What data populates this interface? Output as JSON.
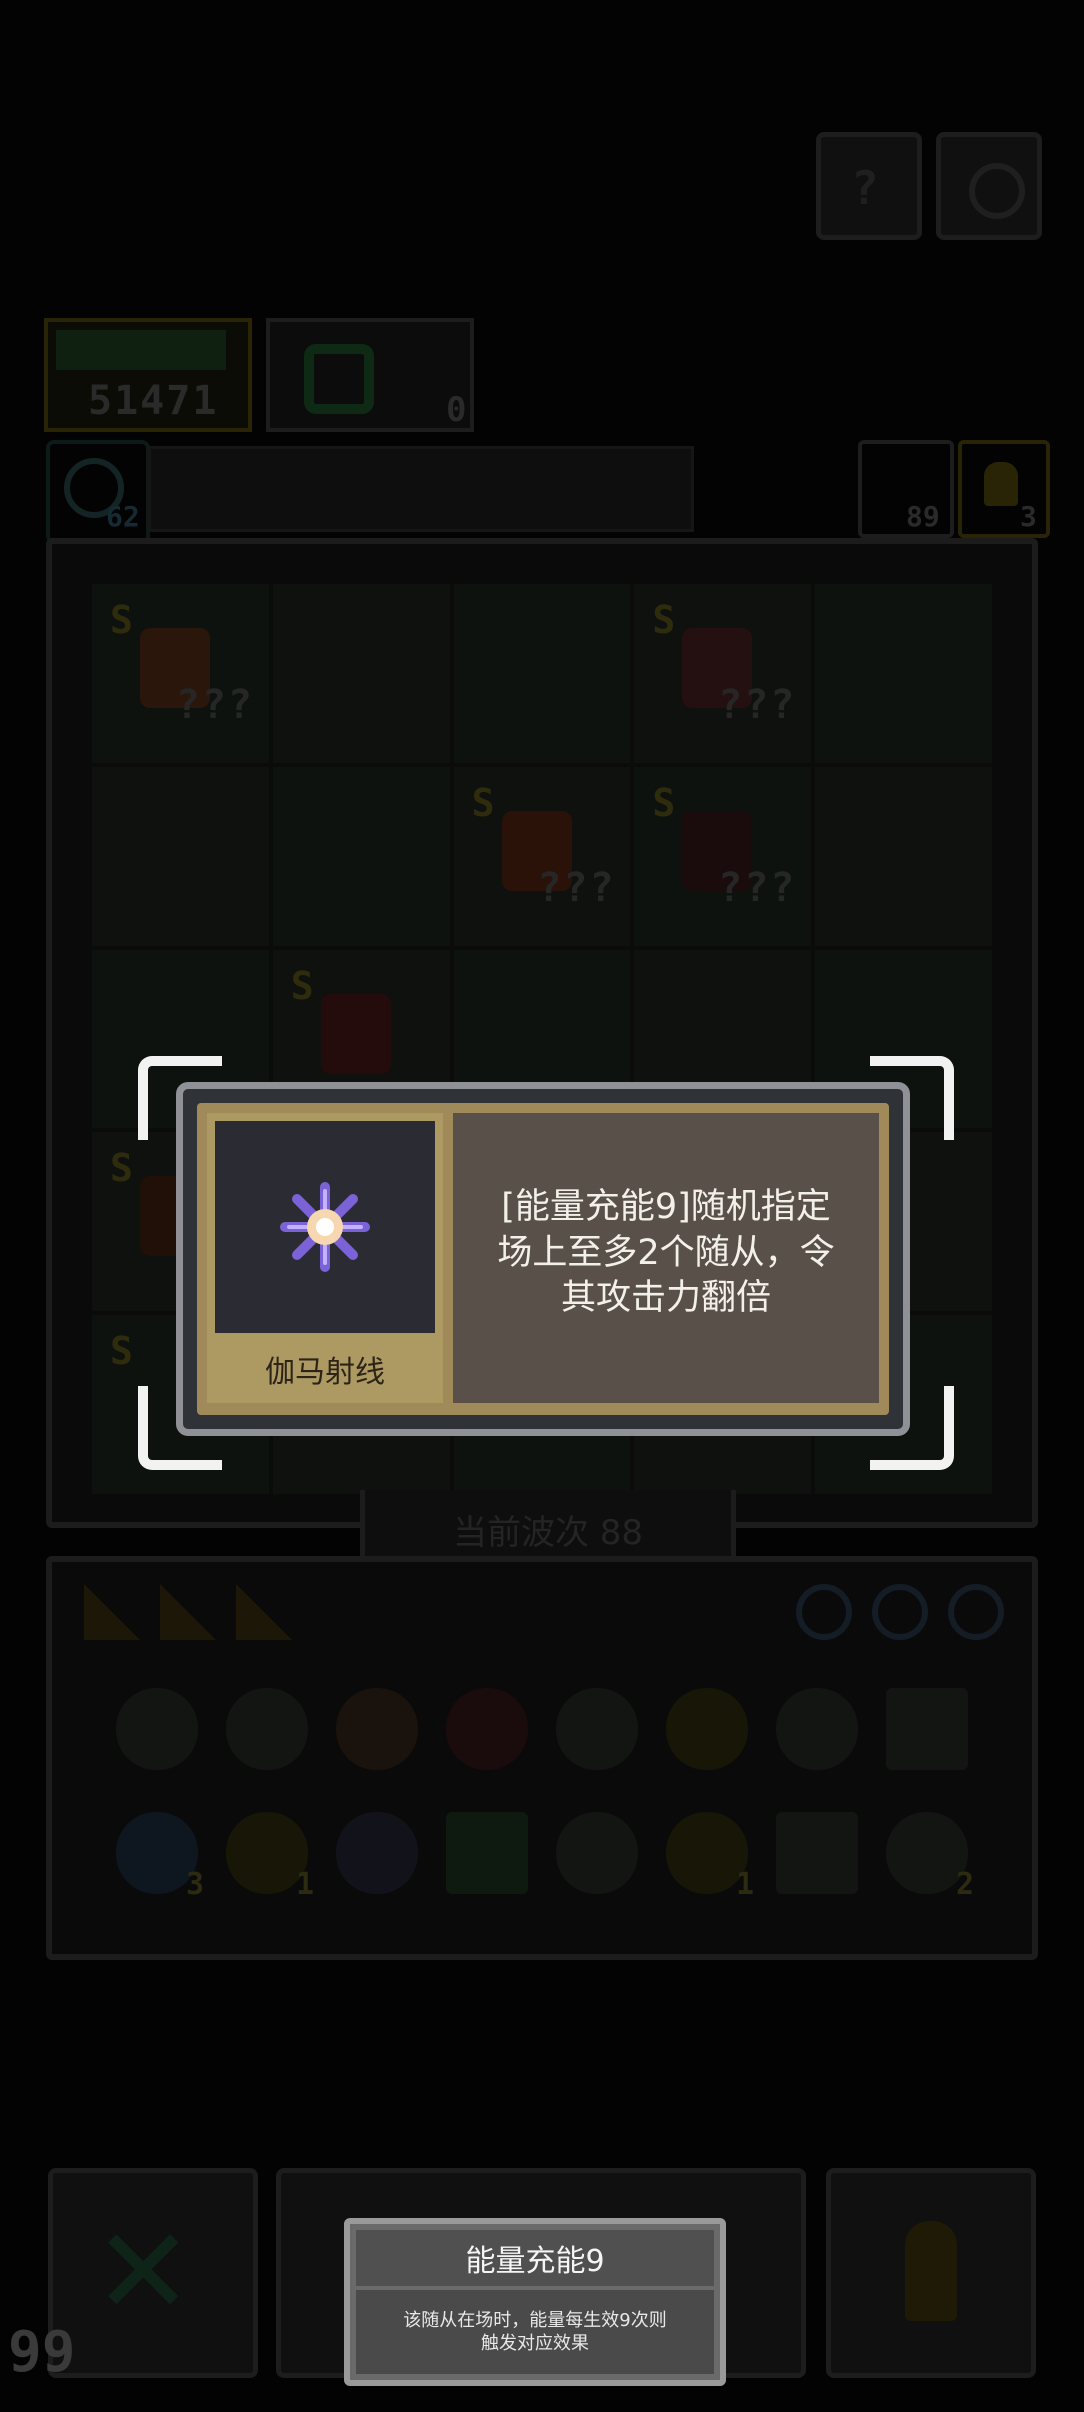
{
  "hud": {
    "gold_amount": "51471",
    "gem_count": "0",
    "energy_value": "62",
    "wave_counter": "89",
    "unit_counter": "3"
  },
  "board": {
    "unknown_label": "???",
    "rank_label": "S",
    "wave_label": "当前波次 88"
  },
  "inventory": {
    "counts": [
      "3",
      "1",
      "1",
      "2"
    ]
  },
  "bottom": {
    "lives": "99"
  },
  "popup": {
    "item_name": "伽马射线",
    "desc_line1": "[能量充能9]随机指定",
    "desc_line2": "场上至多2个随从，令",
    "desc_line3": "其攻击力翻倍"
  },
  "tooltip": {
    "title": "能量充能9",
    "body_line1": "该随从在场时，能量每生效9次则",
    "body_line2": "触发对应效果"
  },
  "colors": {
    "card_frame": "#8f9196",
    "card_gold": "#ad9a62",
    "card_desc_bg": "#59504a",
    "icon_bg": "#2b2b33",
    "spark": "#b99cf2"
  }
}
